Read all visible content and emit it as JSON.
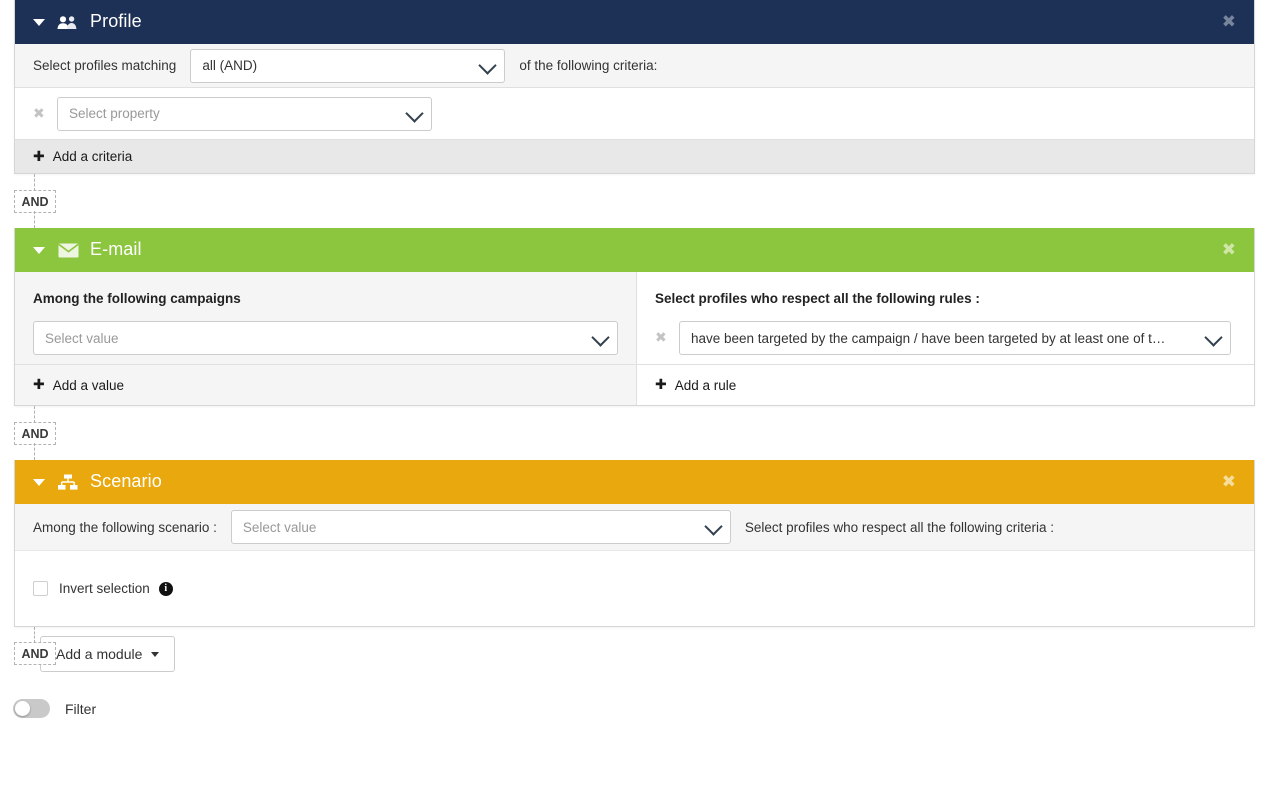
{
  "modules": {
    "profile": {
      "title": "Profile",
      "icon": "users-group-icon",
      "close_label": "✖",
      "header_color": "#1d3055",
      "match_prefix": "Select profiles matching",
      "match_value": "all (AND)",
      "match_suffix": "of the following criteria:",
      "criteria_placeholder": "Select property",
      "remove_label": "✖",
      "add_criteria_label": "Add a criteria",
      "plus_glyph": "✚"
    },
    "email": {
      "title": "E-mail",
      "icon": "envelope-icon",
      "close_label": "✖",
      "header_color": "#8cc63e",
      "left_heading": "Among the following campaigns",
      "left_placeholder": "Select value",
      "left_add_label": "Add a value",
      "right_heading": "Select profiles who respect all the following rules :",
      "right_rule_value": "have been targeted by the campaign / have been targeted by at least one of t…",
      "right_add_label": "Add a rule",
      "remove_label": "✖",
      "plus_glyph": "✚"
    },
    "scenario": {
      "title": "Scenario",
      "icon": "sitemap-icon",
      "close_label": "✖",
      "header_color": "#e9a80d",
      "prefix_label": "Among the following scenario :",
      "select_placeholder": "Select value",
      "suffix_label": "Select profiles who respect all the following criteria :",
      "invert_label": "Invert selection",
      "info_glyph": "i"
    }
  },
  "connectors": {
    "and_label": "AND"
  },
  "toolbar": {
    "and_label": "AND",
    "add_module_label": "Add a module"
  },
  "footer": {
    "filter_label": "Filter",
    "filter_on": false
  }
}
